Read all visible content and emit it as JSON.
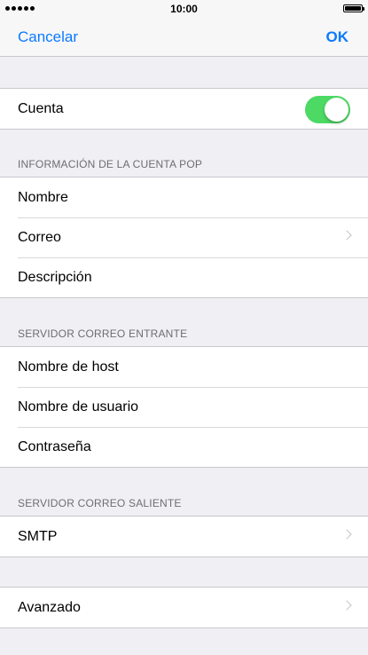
{
  "status_bar": {
    "time": "10:00",
    "signal_icon": "signal-dots-icon",
    "battery_icon": "battery-icon"
  },
  "nav": {
    "cancel_label": "Cancelar",
    "done_label": "OK",
    "accent_color": "#0a7aff"
  },
  "account": {
    "label": "Cuenta",
    "toggle_on": true,
    "toggle_color": "#4cd964"
  },
  "pop_section": {
    "header": "INFORMACIÓN DE LA CUENTA POP",
    "rows": [
      {
        "label": "Nombre"
      },
      {
        "label": "Correo"
      },
      {
        "label": "Descripción"
      }
    ]
  },
  "incoming_section": {
    "header": "SERVIDOR CORREO ENTRANTE",
    "rows": [
      {
        "label": "Nombre de host"
      },
      {
        "label": "Nombre de usuario"
      },
      {
        "label": "Contraseña"
      }
    ]
  },
  "outgoing_section": {
    "header": "SERVIDOR CORREO SALIENTE",
    "rows": [
      {
        "label": "SMTP"
      }
    ]
  },
  "advanced": {
    "label": "Avanzado"
  }
}
